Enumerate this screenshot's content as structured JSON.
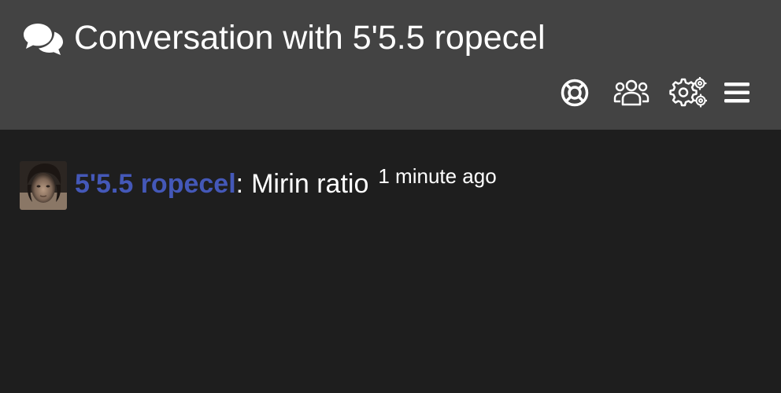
{
  "header": {
    "title": "Conversation with 5'5.5 ropecel",
    "title_icon": "comments-icon",
    "toolbar": [
      {
        "icon": "lifebuoy-icon"
      },
      {
        "icon": "users-icon"
      },
      {
        "icon": "settings-icon"
      },
      {
        "icon": "hamburger-menu-icon"
      }
    ]
  },
  "messages": [
    {
      "author": "5'5.5 ropecel",
      "separator": ":",
      "text": "Mirin ratio",
      "time": "1 minute ago"
    }
  ],
  "colors": {
    "header_bg": "#434343",
    "page_bg": "#1e1e1e",
    "username": "#4458b8",
    "text": "#ffffff"
  }
}
